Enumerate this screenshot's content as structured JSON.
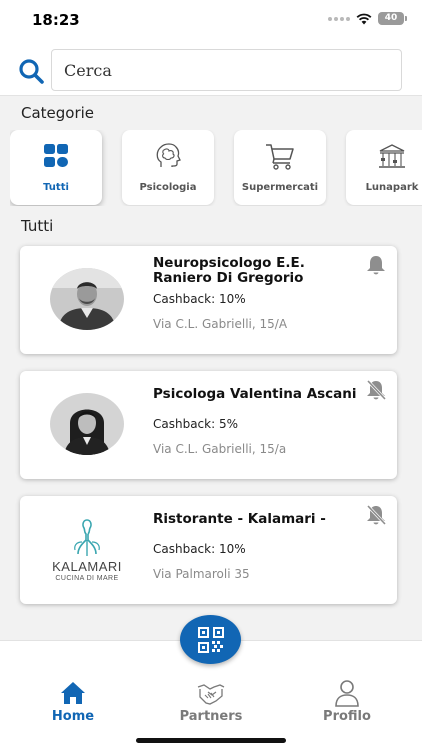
{
  "status_bar": {
    "time": "18:23",
    "battery": "40",
    "icons": [
      "signal-icon",
      "wifi-icon",
      "battery-icon"
    ]
  },
  "search": {
    "placeholder": "Cerca",
    "icon": "search-icon"
  },
  "categories": {
    "title": "Categorie",
    "items": [
      {
        "label": "Tutti",
        "icon": "grid-icon",
        "selected": true
      },
      {
        "label": "Psicologia",
        "icon": "brain-icon",
        "selected": false
      },
      {
        "label": "Supermercati",
        "icon": "cart-icon",
        "selected": false
      },
      {
        "label": "Lunapark",
        "icon": "carousel-icon",
        "selected": false
      }
    ]
  },
  "list": {
    "title": "Tutti",
    "partners": [
      {
        "name": "Neuropsicologo E.E. Raniero Di Gregorio",
        "cashback": "Cashback: 10%",
        "address": "Via C.L. Gabrielli, 15/A",
        "bell": "bell-icon",
        "image": "man-portrait"
      },
      {
        "name": "Psicologa Valentina Ascani",
        "cashback": "Cashback: 5%",
        "address": "Via C.L. Gabrielli, 15/a",
        "bell": "bell-off-icon",
        "image": "woman-portrait"
      },
      {
        "name": "Ristorante - Kalamari -",
        "cashback": "Cashback: 10%",
        "address": "Via Palmaroli 35",
        "bell": "bell-off-icon",
        "image": "kalamari-logo",
        "logo_text": "KALAMARI",
        "logo_subtext": "CUCINA DI MARE"
      }
    ]
  },
  "fab": {
    "icon": "qr-code-icon"
  },
  "bottom_nav": {
    "items": [
      {
        "label": "Home",
        "icon": "home-icon",
        "active": true
      },
      {
        "label": "Partners",
        "icon": "handshake-icon",
        "active": false
      },
      {
        "label": "Profilo",
        "icon": "user-icon",
        "active": false
      }
    ]
  },
  "colors": {
    "accent": "#1166b4",
    "background": "#f2f2f2",
    "card": "#ffffff",
    "muted_text": "#8a8a8a"
  }
}
